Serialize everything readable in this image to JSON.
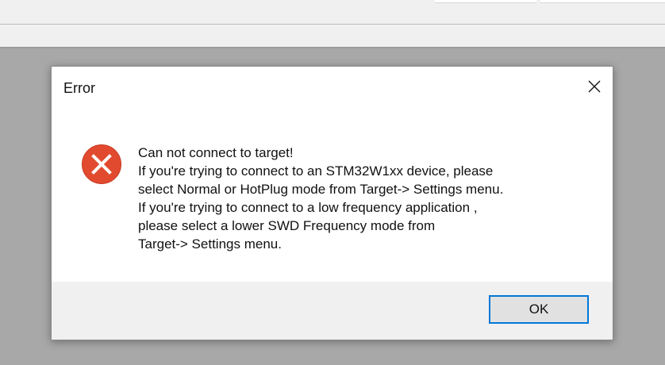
{
  "dialog": {
    "title": "Error",
    "message_lines": [
      "Can not connect to target!",
      "If you're trying to connect to an STM32W1xx device, please",
      "select Normal or HotPlug mode from Target-> Settings menu.",
      "If you're trying to connect to a low frequency application ,",
      "please select a lower SWD Frequency mode from",
      "Target-> Settings menu."
    ],
    "ok_label": "OK",
    "icons": {
      "close": "close-icon",
      "error": "error-icon"
    }
  },
  "colors": {
    "error_red": "#e24a2f",
    "focus_blue": "#0078d7",
    "backdrop_gray": "#a8a8a8"
  }
}
